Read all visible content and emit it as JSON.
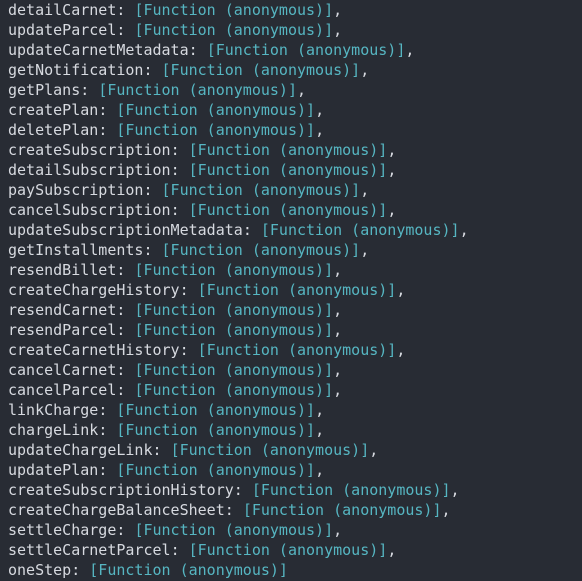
{
  "console": {
    "theme": {
      "background": "#282c34",
      "key_color": "#d7dae0",
      "punctuation_color": "#d7dae0",
      "function_value_color": "#56b6c2"
    },
    "value_text": "[Function (anonymous)]",
    "separator": ": ",
    "comma": ",",
    "lines": [
      {
        "key": "detailCarnet",
        "value": "[Function (anonymous)]",
        "trailing": ","
      },
      {
        "key": "updateParcel",
        "value": "[Function (anonymous)]",
        "trailing": ","
      },
      {
        "key": "updateCarnetMetadata",
        "value": "[Function (anonymous)]",
        "trailing": ","
      },
      {
        "key": "getNotification",
        "value": "[Function (anonymous)]",
        "trailing": ","
      },
      {
        "key": "getPlans",
        "value": "[Function (anonymous)]",
        "trailing": ","
      },
      {
        "key": "createPlan",
        "value": "[Function (anonymous)]",
        "trailing": ","
      },
      {
        "key": "deletePlan",
        "value": "[Function (anonymous)]",
        "trailing": ","
      },
      {
        "key": "createSubscription",
        "value": "[Function (anonymous)]",
        "trailing": ","
      },
      {
        "key": "detailSubscription",
        "value": "[Function (anonymous)]",
        "trailing": ","
      },
      {
        "key": "paySubscription",
        "value": "[Function (anonymous)]",
        "trailing": ","
      },
      {
        "key": "cancelSubscription",
        "value": "[Function (anonymous)]",
        "trailing": ","
      },
      {
        "key": "updateSubscriptionMetadata",
        "value": "[Function (anonymous)]",
        "trailing": ","
      },
      {
        "key": "getInstallments",
        "value": "[Function (anonymous)]",
        "trailing": ","
      },
      {
        "key": "resendBillet",
        "value": "[Function (anonymous)]",
        "trailing": ","
      },
      {
        "key": "createChargeHistory",
        "value": "[Function (anonymous)]",
        "trailing": ","
      },
      {
        "key": "resendCarnet",
        "value": "[Function (anonymous)]",
        "trailing": ","
      },
      {
        "key": "resendParcel",
        "value": "[Function (anonymous)]",
        "trailing": ","
      },
      {
        "key": "createCarnetHistory",
        "value": "[Function (anonymous)]",
        "trailing": ","
      },
      {
        "key": "cancelCarnet",
        "value": "[Function (anonymous)]",
        "trailing": ","
      },
      {
        "key": "cancelParcel",
        "value": "[Function (anonymous)]",
        "trailing": ","
      },
      {
        "key": "linkCharge",
        "value": "[Function (anonymous)]",
        "trailing": ","
      },
      {
        "key": "chargeLink",
        "value": "[Function (anonymous)]",
        "trailing": ","
      },
      {
        "key": "updateChargeLink",
        "value": "[Function (anonymous)]",
        "trailing": ","
      },
      {
        "key": "updatePlan",
        "value": "[Function (anonymous)]",
        "trailing": ","
      },
      {
        "key": "createSubscriptionHistory",
        "value": "[Function (anonymous)]",
        "trailing": ","
      },
      {
        "key": "createChargeBalanceSheet",
        "value": "[Function (anonymous)]",
        "trailing": ","
      },
      {
        "key": "settleCharge",
        "value": "[Function (anonymous)]",
        "trailing": ","
      },
      {
        "key": "settleCarnetParcel",
        "value": "[Function (anonymous)]",
        "trailing": ","
      },
      {
        "key": "oneStep",
        "value": "[Function (anonymous)]",
        "trailing": ""
      }
    ]
  }
}
